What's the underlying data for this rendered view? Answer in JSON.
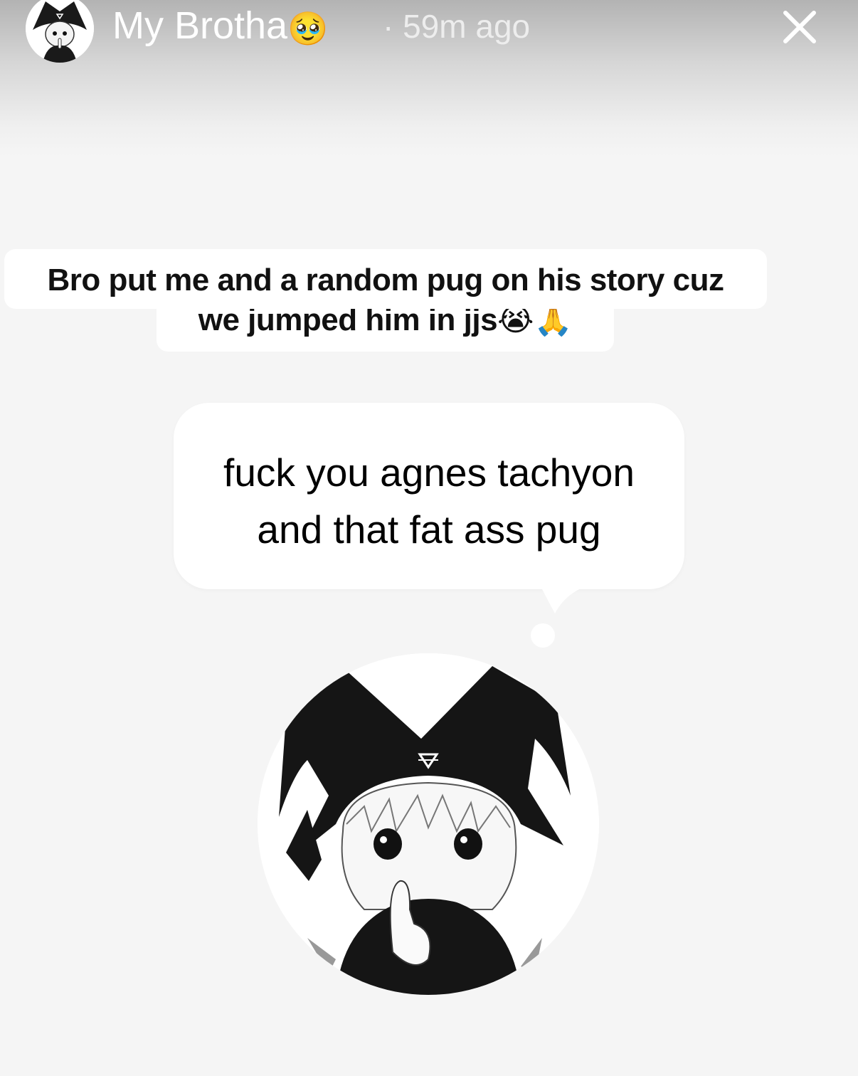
{
  "header": {
    "username": "My Brotha",
    "username_emoji": "🥹",
    "timestamp": "· 59m ago",
    "close_label": "×"
  },
  "caption": {
    "line1": "Bro put me and a random pug on his story cuz",
    "line2": "we jumped him in jjs😭🙏"
  },
  "prompt_bubble": {
    "text": "fuck you agnes tachyon\nand that fat ass pug"
  },
  "colors": {
    "background": "#f5f5f5",
    "bubble": "#ffffff",
    "header_text": "#ffffff"
  },
  "icons": {
    "close": "close-icon",
    "avatar": "jester-avatar"
  }
}
